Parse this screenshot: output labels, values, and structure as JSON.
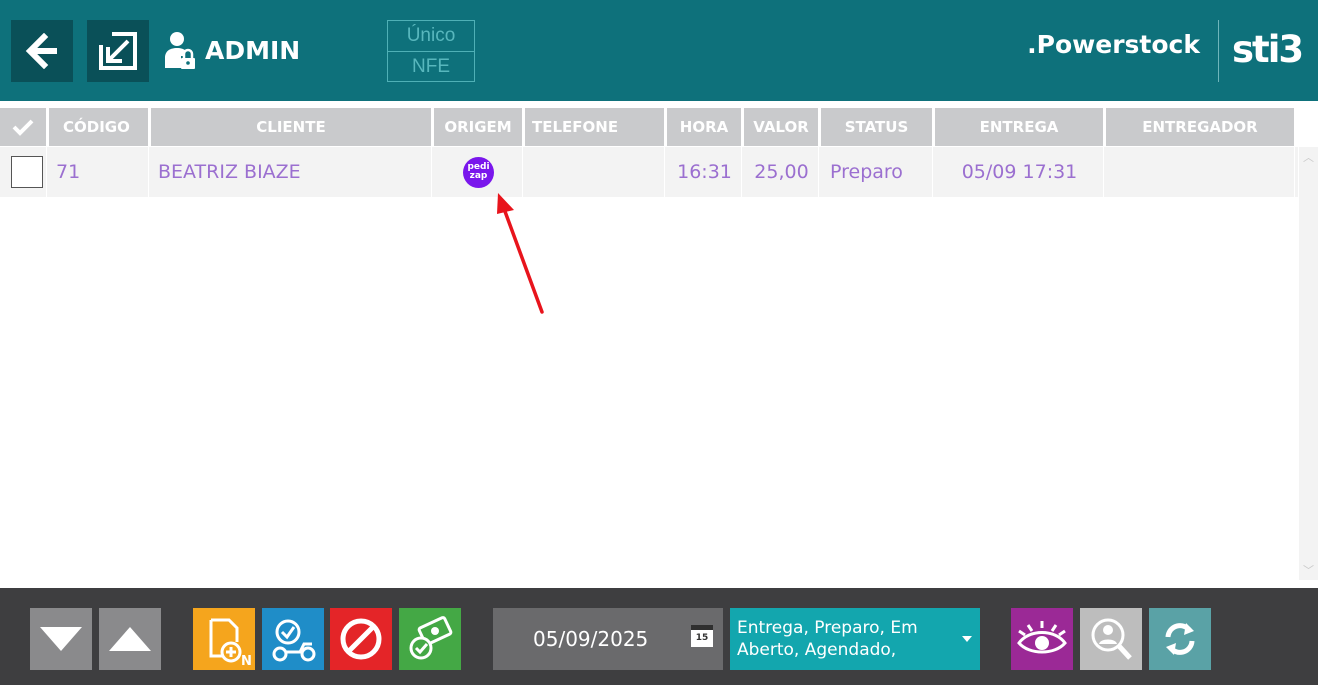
{
  "header": {
    "user": "ADMIN",
    "modes": [
      "Único",
      "NFE"
    ],
    "brand": ".Powerstock",
    "logo": "sti3"
  },
  "table": {
    "columns": [
      "CÓDIGO",
      "CLIENTE",
      "ORIGEM",
      "TELEFONE",
      "HORA",
      "VALOR",
      "STATUS",
      "ENTREGA",
      "ENTREGADOR"
    ],
    "rows": [
      {
        "codigo": "71",
        "cliente": "BEATRIZ BIAZE",
        "origem_badge": [
          "pedi",
          "zap"
        ],
        "telefone": "",
        "hora": "16:31",
        "valor": "25,00",
        "status": "Preparo",
        "entrega": "05/09 17:31",
        "entregador": ""
      }
    ]
  },
  "footer": {
    "date": "05/09/2025",
    "calendar_day": "15",
    "status_filter": "Entrega, Preparo, Em Aberto, Agendado,",
    "new_badge": "N"
  },
  "colors": {
    "header_bg": "#0e717b",
    "accent_text": "#9b6fd0",
    "footer_bg": "#3e3e40",
    "arrow": "#e8141c"
  }
}
